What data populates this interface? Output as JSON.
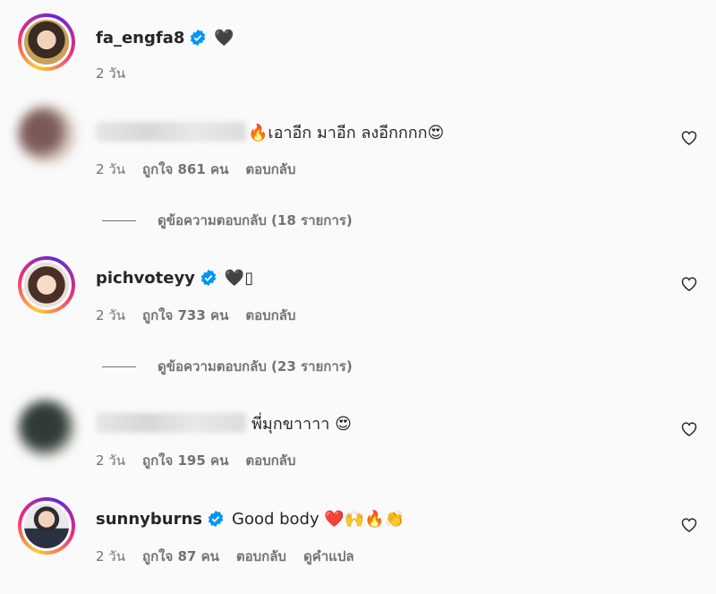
{
  "comments": [
    {
      "username": "fa_engfa8",
      "verified": true,
      "text": "🖤",
      "time": "2 วัน",
      "likes": "",
      "reply_label": "",
      "translate_label": ""
    },
    {
      "username": "",
      "verified": false,
      "text": "🔥เอาอีก มาอีก ลงอีกกกก😍",
      "time": "2 วัน",
      "likes": "ถูกใจ 861 คน",
      "reply_label": "ตอบกลับ",
      "view_replies": "ดูข้อความตอบกลับ (18 รายการ)"
    },
    {
      "username": "pichvoteyy",
      "verified": true,
      "text": "🖤▯",
      "time": "2 วัน",
      "likes": "ถูกใจ 733 คน",
      "reply_label": "ตอบกลับ",
      "view_replies": "ดูข้อความตอบกลับ (23 รายการ)"
    },
    {
      "username": "",
      "verified": false,
      "text": "พี่มุกขาาาา 😍",
      "time": "2 วัน",
      "likes": "ถูกใจ 195 คน",
      "reply_label": "ตอบกลับ"
    },
    {
      "username": "sunnyburns",
      "verified": true,
      "text": "Good body ❤️🙌🔥👏",
      "time": "2 วัน",
      "likes": "ถูกใจ 87 คน",
      "reply_label": "ตอบกลับ",
      "translate_label": "ดูคำแปล"
    }
  ],
  "colors": {
    "verified": "#0095f6",
    "muted": "#737373",
    "text": "#262626"
  },
  "icons": {
    "like": "heart-outline-icon",
    "verified": "verified-badge-icon"
  }
}
